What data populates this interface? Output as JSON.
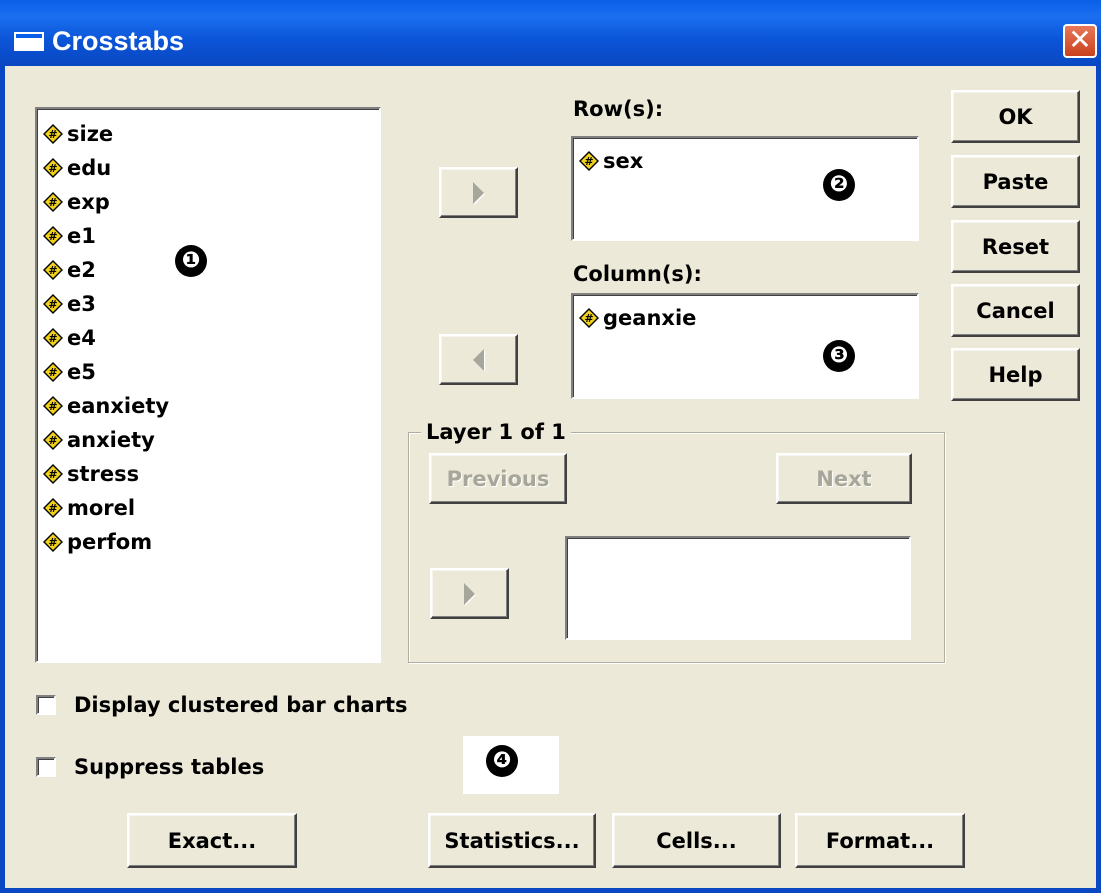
{
  "window": {
    "title": "Crosstabs"
  },
  "source_variables": [
    "size",
    "edu",
    "exp",
    "e1",
    "e2",
    "e3",
    "e4",
    "e5",
    "eanxiety",
    "anxiety",
    "stress",
    "morel",
    "perfom"
  ],
  "rows": {
    "label": "Row(s):",
    "items": [
      "sex"
    ]
  },
  "columns": {
    "label": "Column(s):",
    "items": [
      "geanxie"
    ]
  },
  "layer": {
    "label": "Layer 1 of 1",
    "previous_label": "Previous",
    "next_label": "Next"
  },
  "buttons": {
    "ok": "OK",
    "paste": "Paste",
    "reset": "Reset",
    "cancel": "Cancel",
    "help": "Help"
  },
  "options": {
    "clustered_bar": {
      "label": "Display clustered bar charts",
      "checked": false
    },
    "suppress_tables": {
      "label": "Suppress tables",
      "checked": false
    }
  },
  "bottom_buttons": {
    "exact": "Exact...",
    "statistics": "Statistics...",
    "cells": "Cells...",
    "format": "Format..."
  },
  "markers": [
    "❶",
    "❷",
    "❸",
    "❹"
  ],
  "icons": {
    "variable": "scale-variable-icon",
    "close": "close-icon",
    "window": "window-icon"
  },
  "colors": {
    "titlebar": "#0a5fe8",
    "face": "#ece9d8",
    "close": "#c9411d"
  }
}
